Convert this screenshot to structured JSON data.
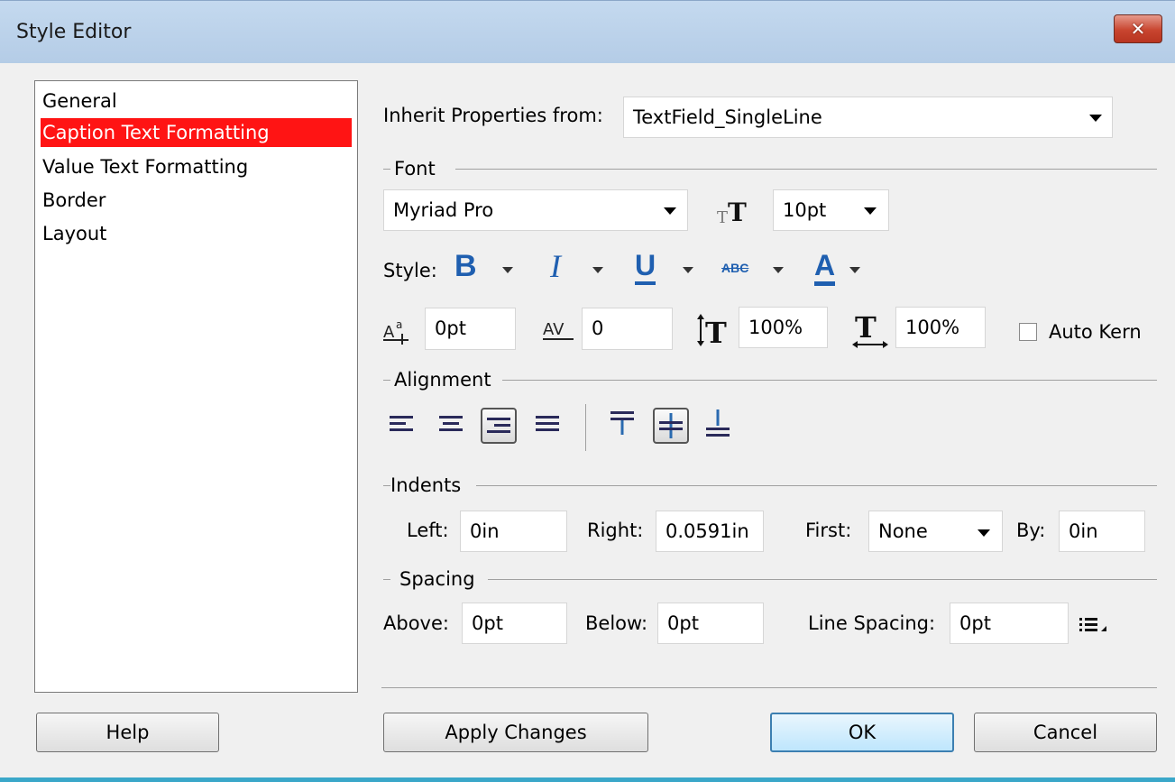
{
  "window": {
    "title": "Style Editor",
    "close_glyph": "✕"
  },
  "categories": [
    {
      "label": "General",
      "selected": false
    },
    {
      "label": "Caption Text Formatting",
      "selected": true
    },
    {
      "label": "Value Text Formatting",
      "selected": false
    },
    {
      "label": "Border",
      "selected": false
    },
    {
      "label": "Layout",
      "selected": false
    }
  ],
  "inherit": {
    "label": "Inherit Properties from:",
    "value": "TextField_SingleLine"
  },
  "font": {
    "section": "Font",
    "family": "Myriad Pro",
    "size": "10pt",
    "style_label": "Style:",
    "bold_glyph": "B",
    "italic_glyph": "I",
    "underline_glyph": "U",
    "strike_glyph": "ABC",
    "color_glyph": "A",
    "text_color": "#1f5fb0",
    "baseline_shift": "0pt",
    "kerning": "0",
    "vertical_scale": "100%",
    "horizontal_scale": "100%",
    "auto_kern_label": "Auto Kern",
    "auto_kern_checked": false
  },
  "alignment": {
    "section": "Alignment",
    "horizontal": [
      "left",
      "center",
      "right",
      "justify"
    ],
    "horizontal_selected": "right",
    "vertical": [
      "top",
      "middle",
      "bottom"
    ],
    "vertical_selected": "middle"
  },
  "indents": {
    "section": "Indents",
    "left_label": "Left:",
    "left_value": "0in",
    "right_label": "Right:",
    "right_value": "0.0591in",
    "first_label": "First:",
    "first_value": "None",
    "by_label": "By:",
    "by_value": "0in"
  },
  "spacing": {
    "section": "Spacing",
    "above_label": "Above:",
    "above_value": "0pt",
    "below_label": "Below:",
    "below_value": "0pt",
    "line_label": "Line Spacing:",
    "line_value": "0pt",
    "line_menu_icon": "list-menu-icon"
  },
  "buttons": {
    "help": "Help",
    "apply": "Apply Changes",
    "ok": "OK",
    "cancel": "Cancel"
  }
}
